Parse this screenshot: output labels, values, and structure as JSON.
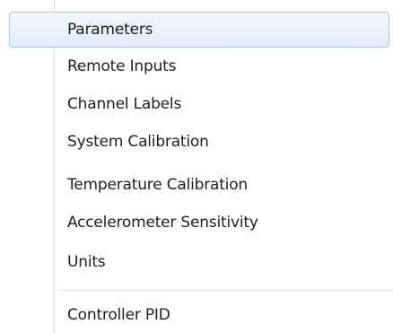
{
  "menu": {
    "items": [
      {
        "label": "Parameters"
      },
      {
        "label": "Remote Inputs"
      },
      {
        "label": "Channel Labels"
      },
      {
        "label": "System Calibration"
      },
      {
        "label": "Temperature Calibration"
      },
      {
        "label": "Accelerometer Sensitivity"
      },
      {
        "label": "Units"
      },
      {
        "label": "Controller PID"
      }
    ],
    "highlight_color": "#e2ecf8",
    "highlight_border_color": "#a8c6ea"
  }
}
